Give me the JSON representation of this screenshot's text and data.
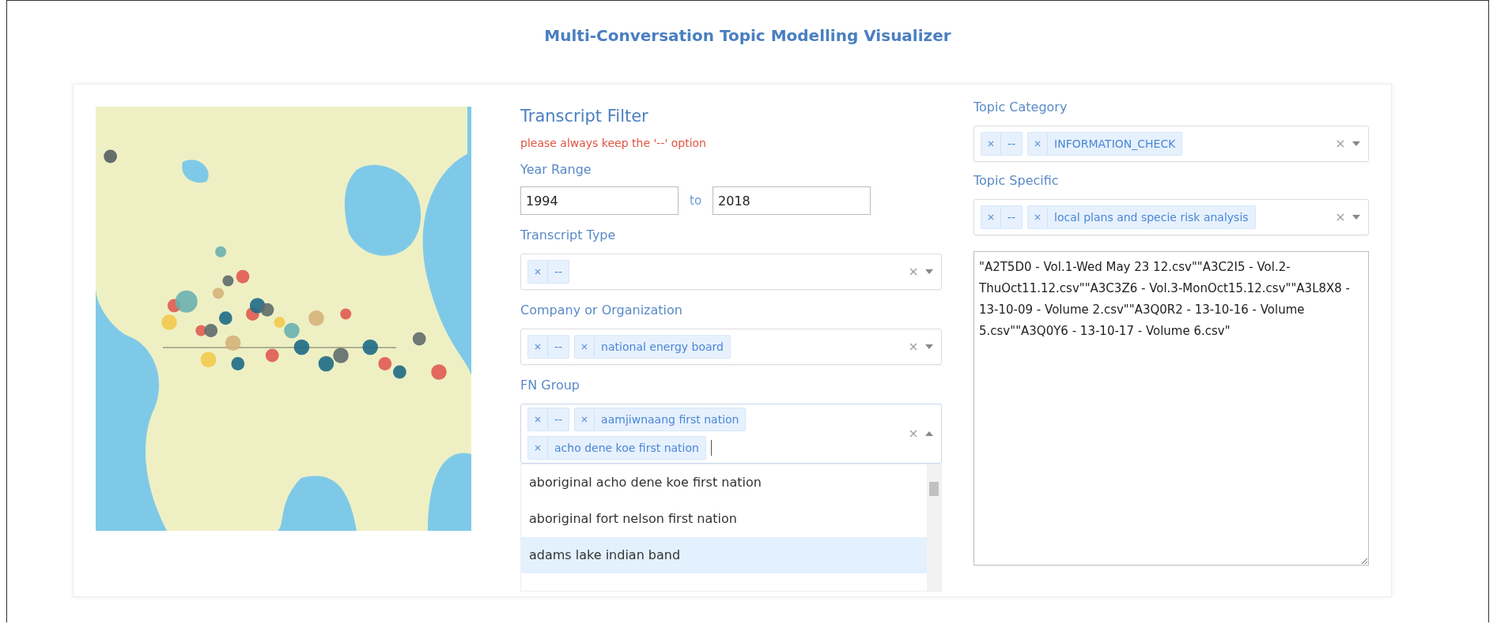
{
  "title": "Multi-Conversation Topic Modelling Visualizer",
  "filter": {
    "heading": "Transcript Filter",
    "warning": "please always keep the '--' option",
    "year_range": {
      "label": "Year Range",
      "from": "1994",
      "separator": "to",
      "to": "2018"
    },
    "selects": [
      {
        "label": "Transcript Type",
        "expanded": false,
        "tags": [
          "--"
        ]
      },
      {
        "label": "Company or Organization",
        "expanded": false,
        "tags": [
          "--",
          "national energy board"
        ]
      },
      {
        "label": "FN Group",
        "expanded": true,
        "tags": [
          "--",
          "aamjiwnaang first nation",
          "acho dene koe first nation"
        ],
        "options": [
          {
            "label": "aboriginal acho dene koe first nation",
            "selected": false
          },
          {
            "label": "aboriginal fort nelson first nation",
            "selected": false
          },
          {
            "label": "adams lake indian band",
            "selected": true
          }
        ]
      }
    ]
  },
  "topics": {
    "selects": [
      {
        "label": "Topic Category",
        "expanded": false,
        "tags": [
          "--",
          "INFORMATION_CHECK"
        ]
      },
      {
        "label": "Topic Specific",
        "expanded": false,
        "tags": [
          "--",
          "local plans and specie risk analysis"
        ]
      }
    ],
    "files": "\"A2T5D0 - Vol.1-Wed May 23 12.csv\"\"A3C2I5 - Vol.2-ThuOct11.12.csv\"\"A3C3Z6 - Vol.3-MonOct15.12.csv\"\"A3L8X8 - 13-10-09 - Volume 2.csv\"\"A3Q0R2 - 13-10-16 - Volume 5.csv\"\"A3Q0Y6 - 13-10-17 - Volume 6.csv\""
  }
}
